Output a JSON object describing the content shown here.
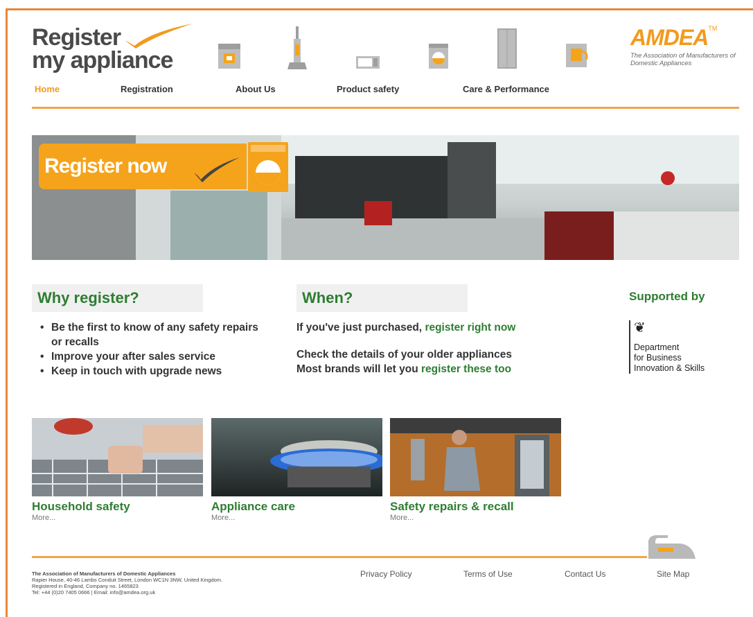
{
  "header": {
    "logo_line1": "Register",
    "logo_line2": "my appliance",
    "amdea_brand": "AMDEA",
    "amdea_tm": "TM",
    "amdea_sub": "The Association of Manufacturers of Domestic Appliances"
  },
  "nav": {
    "items": [
      {
        "label": "Home",
        "active": true
      },
      {
        "label": "Registration"
      },
      {
        "label": "About Us"
      },
      {
        "label": "Product safety"
      },
      {
        "label": "Care & Performance"
      }
    ]
  },
  "hero": {
    "cta_label": "Register now"
  },
  "why": {
    "title": "Why register?",
    "bullets": [
      "Be the first to know of any safety repairs or recalls",
      "Improve your after sales service",
      "Keep in touch with upgrade news"
    ]
  },
  "when": {
    "title": "When?",
    "line1_prefix": "If you've just purchased,",
    "line1_link": "register right now",
    "line2": "Check the details of your older appliances",
    "line3_prefix": "Most brands will let you",
    "line3_link": "register these too"
  },
  "support": {
    "title": "Supported by",
    "org_line1": "Department",
    "org_line2": "for Business",
    "org_line3": "Innovation & Skills"
  },
  "tiles": [
    {
      "title": "Household safety",
      "more": "More..."
    },
    {
      "title": "Appliance care",
      "more": "More..."
    },
    {
      "title": "Safety repairs & recall",
      "more": "More..."
    }
  ],
  "footer": {
    "org_name": "The Association of Manufacturers of Domestic Appliances",
    "address": "Rapier House, 40-46 Lambs Conduit Street, London WC1N 3NW, United Kingdom.",
    "registration": "Registered in England, Company no. 1465823",
    "contact": "Tel: +44 (0)20 7405 0666 | Email: info@amdea.org.uk",
    "links": [
      "Privacy Policy",
      "Terms of Use",
      "Contact Us",
      "Site Map"
    ]
  },
  "colors": {
    "accent_orange": "#f29a1d",
    "heading_green": "#2e7d32",
    "rule_orange": "#f0a54a"
  }
}
